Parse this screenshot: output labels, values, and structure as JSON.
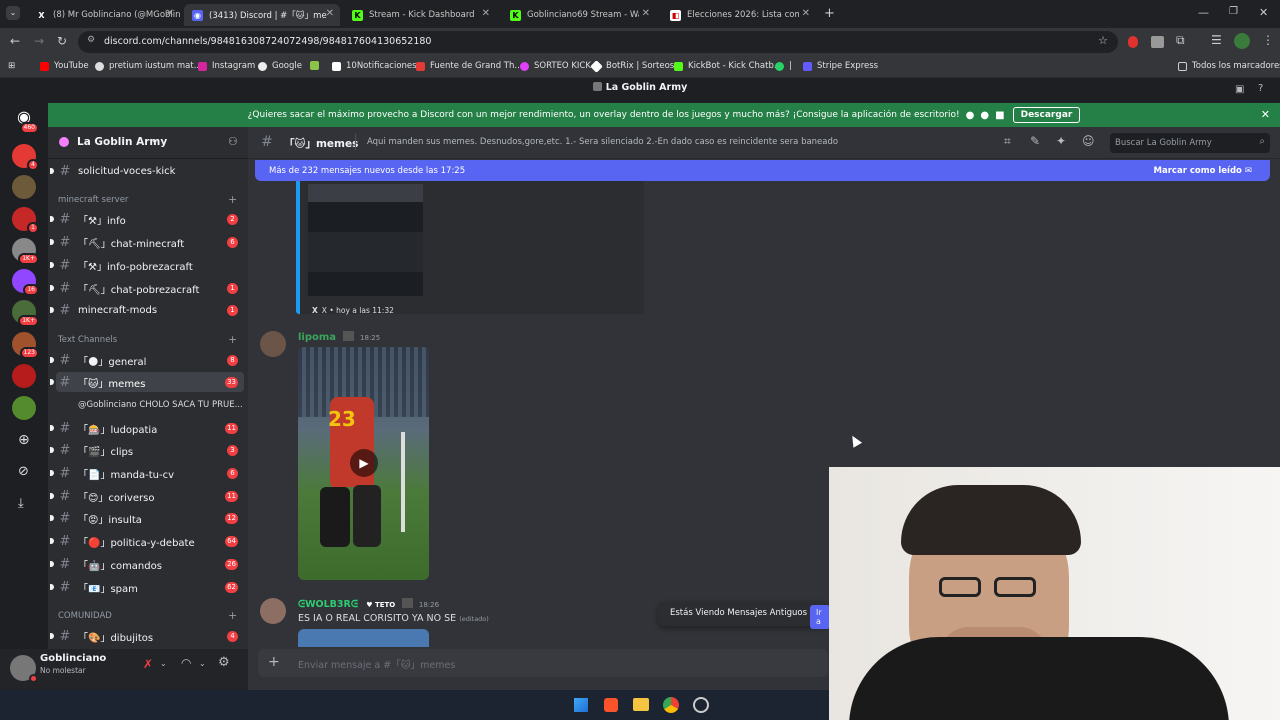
{
  "browser": {
    "tabs": [
      {
        "title": "(8) Mr Goblinciano (@MGoblin...",
        "icon": "x-logo"
      },
      {
        "title": "(3413) Discord | #「🐱」memes",
        "icon": "discord-logo",
        "active": true
      },
      {
        "title": "Stream - Kick Dashboard",
        "icon": "kick-logo"
      },
      {
        "title": "Goblinciano69 Stream - Watch",
        "icon": "kick-logo"
      },
      {
        "title": "Elecciones 2026: Lista complet",
        "icon": "news-logo"
      }
    ],
    "url": "discord.com/channels/984816308724072498/984817604130652180",
    "bookmarks": [
      "YouTube",
      "pretium iustum mat...",
      "Instagram",
      "Google",
      "",
      "10Notificaciones",
      "Fuente de Grand Th...",
      "SORTEO KICK",
      "BotRix | Sorteos",
      "KickBot - Kick Chatb...",
      "|",
      "Stripe Express"
    ],
    "bookmarks_right": "Todos los marcadores"
  },
  "discord": {
    "window_title": "La Goblin Army",
    "banner_text": "¿Quieres sacar el máximo provecho a Discord con un mejor rendimiento, un overlay dentro de los juegos y mucho más? ¡Consigue la aplicación de escritorio!",
    "banner_button": "Descargar",
    "home_badge": "460",
    "guild_badges": [
      "4",
      "",
      "1",
      "1K+",
      "16",
      "1K+",
      "123",
      "",
      ""
    ],
    "server_name": "La Goblin Army",
    "channels": [
      {
        "name": "solicitud-voces-kick",
        "badge": "",
        "unread": true,
        "plain": true
      },
      {
        "category": "minecraft server"
      },
      {
        "name": "「⚒」info",
        "badge": "2",
        "unread": true
      },
      {
        "name": "「⛏」chat-minecraft",
        "badge": "6",
        "unread": true
      },
      {
        "name": "「⚒」info-pobrezacraft",
        "badge": "",
        "unread": true
      },
      {
        "name": "「⛏」chat-pobrezacraft",
        "badge": "1",
        "unread": true
      },
      {
        "name": "minecraft-mods",
        "badge": "1",
        "unread": true,
        "plain": true
      },
      {
        "category": "Text Channels"
      },
      {
        "name": "「🌑」general",
        "badge": "8",
        "unread": true
      },
      {
        "name": "「🐱」memes",
        "badge": "33",
        "selected": true
      },
      {
        "thread": "@Goblinciano CHOLO SACA TU PRUE..."
      },
      {
        "name": "「🎰」ludopatia",
        "badge": "11",
        "unread": true
      },
      {
        "name": "「🎬」clips",
        "badge": "3",
        "unread": true
      },
      {
        "name": "「📄」manda-tu-cv",
        "badge": "6",
        "unread": true
      },
      {
        "name": "「😊」coriverso",
        "badge": "11",
        "unread": true
      },
      {
        "name": "「😡」insulta",
        "badge": "12",
        "unread": true
      },
      {
        "name": "「🔴」politica-y-debate",
        "badge": "64",
        "unread": true
      },
      {
        "name": "「🤖」comandos",
        "badge": "26",
        "unread": true
      },
      {
        "name": "「📧」spam",
        "badge": "62",
        "unread": true
      },
      {
        "category": "COMUNIDAD"
      },
      {
        "name": "「🎨」dibujitos",
        "badge": "4",
        "unread": true
      }
    ],
    "user": {
      "name": "Goblinciano",
      "status": "No molestar"
    },
    "channel_header": {
      "name": "「🐱」memes",
      "topic": "Aqui manden sus memes. Desnudos,gore,etc. 1.- Sera silenciado 2.-En dado caso es reincidente sera baneado",
      "search_placeholder": "Buscar La Goblin Army"
    },
    "new_messages_bar": {
      "text": "Más de 232 mensajes nuevos desde las 17:25",
      "action": "Marcar como leído"
    },
    "embed_footer": "X • hoy a las 11:32",
    "messages": [
      {
        "author": "lipoma",
        "time": "18:25",
        "author_color": "#3ba55d"
      },
      {
        "author": "ᕮWOLB3Rᕮ",
        "role": "TETO",
        "time": "18:26",
        "text": "ES IA O REAL CORISITO YA NO SE",
        "edited": "(editado)",
        "author_color": "#2ecc71"
      }
    ],
    "old_messages_notice": "Estás Viendo Mensajes Antiguos",
    "jump_label": "Ir a",
    "composer_placeholder": "Enviar mensaje a #「🐱」memes",
    "video_jersey_number": "23"
  }
}
